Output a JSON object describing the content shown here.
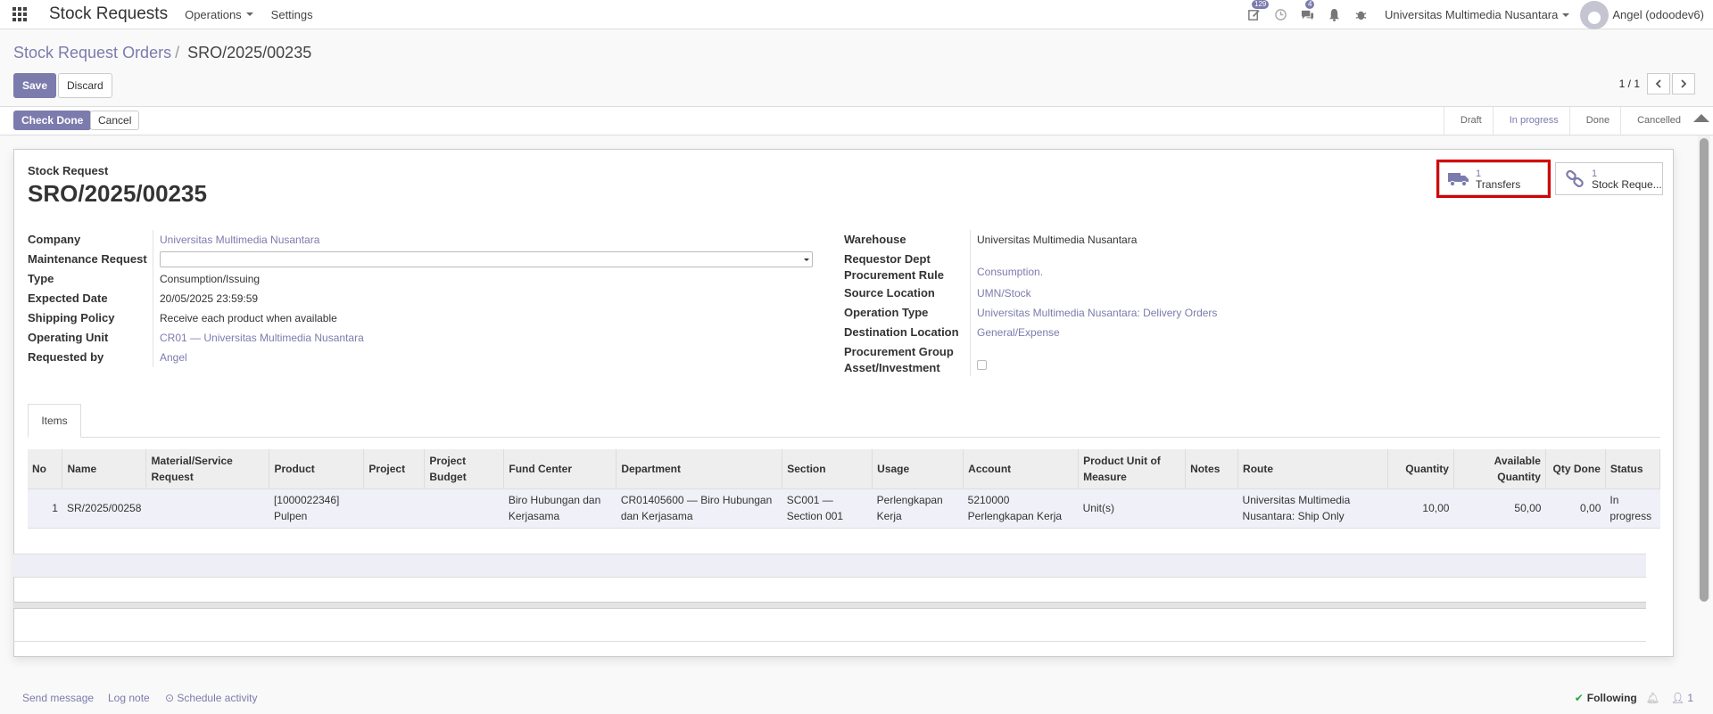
{
  "navbar": {
    "app_title": "Stock Requests",
    "menus": [
      "Operations",
      "Settings"
    ],
    "badges": {
      "activities": "129",
      "messages": "4"
    },
    "company": "Universitas Multimedia Nusantara",
    "user": "Angel (odoodev6)"
  },
  "breadcrumb": {
    "parent": "Stock Request Orders",
    "current": "SRO/2025/00235"
  },
  "toolbar": {
    "save_label": "Save",
    "discard_label": "Discard",
    "pager": "1 / 1"
  },
  "statusbar": {
    "check_done_label": "Check Done",
    "cancel_label": "Cancel",
    "stages": [
      "Draft",
      "In progress",
      "Done",
      "Cancelled"
    ],
    "active_stage": "In progress"
  },
  "sheet": {
    "subtitle": "Stock Request",
    "title": "SRO/2025/00235",
    "smart_buttons": [
      {
        "count": "1",
        "label": "Transfers",
        "icon": "truck-icon",
        "highlighted": true
      },
      {
        "count": "1",
        "label": "Stock Reque...",
        "icon": "link-icon",
        "highlighted": false
      }
    ],
    "left_fields": [
      {
        "label": "Company",
        "value": "Universitas Multimedia Nusantara",
        "link": true
      },
      {
        "label": "Maintenance Request",
        "value": "",
        "type": "select"
      },
      {
        "label": "Type",
        "value": "Consumption/Issuing",
        "link": false
      },
      {
        "label": "Expected Date",
        "value": "20/05/2025 23:59:59",
        "link": false
      },
      {
        "label": "Shipping Policy",
        "value": "Receive each product when available",
        "link": false
      },
      {
        "label": "Operating Unit",
        "value": "CR01 — Universitas Multimedia Nusantara",
        "link": true
      },
      {
        "label": "Requested by",
        "value": "Angel",
        "link": true
      }
    ],
    "right_fields": [
      {
        "label": "Warehouse",
        "value": "Universitas Multimedia Nusantara",
        "link": false
      },
      {
        "label": "Requestor Dept",
        "value": ""
      },
      {
        "label": "Procurement Rule",
        "value": "Consumption.",
        "link": true
      },
      {
        "label": "Source Location",
        "value": "UMN/Stock",
        "link": true
      },
      {
        "label": "Operation Type",
        "value": "Universitas Multimedia Nusantara: Delivery Orders",
        "link": true
      },
      {
        "label": "Destination Location",
        "value": "General/Expense",
        "link": true
      },
      {
        "label": "Procurement Group",
        "value": ""
      },
      {
        "label": "Asset/Investment",
        "value": "",
        "type": "checkbox"
      }
    ],
    "tab_label": "Items"
  },
  "items_table": {
    "columns": [
      "No",
      "Name",
      "Material/Service Request",
      "Product",
      "Project",
      "Project Budget",
      "Fund Center",
      "Department",
      "Section",
      "Usage",
      "Account",
      "Product Unit of Measure",
      "Notes",
      "Route",
      "Quantity",
      "Available Quantity",
      "Qty Done",
      "Status"
    ],
    "rows": [
      [
        "1",
        "SR/2025/00258",
        "",
        "[1000022346] Pulpen",
        "",
        "",
        "Biro Hubungan dan Kerjasama",
        "CR01405600 — Biro Hubungan dan Kerjasama",
        "SC001 — Section 001",
        "Perlengkapan Kerja",
        "5210000 Perlengkapan Kerja",
        "Unit(s)",
        "",
        "Universitas Multimedia Nusantara: Ship Only",
        "10,00",
        "50,00",
        "0,00",
        "In progress"
      ]
    ]
  },
  "chatter": {
    "send_message": "Send message",
    "log_note": "Log note",
    "schedule_activity": "Schedule activity",
    "following": "Following",
    "followers_count": "1"
  },
  "colors": {
    "brand": "#7c7bad",
    "highlight": "#d50000"
  }
}
